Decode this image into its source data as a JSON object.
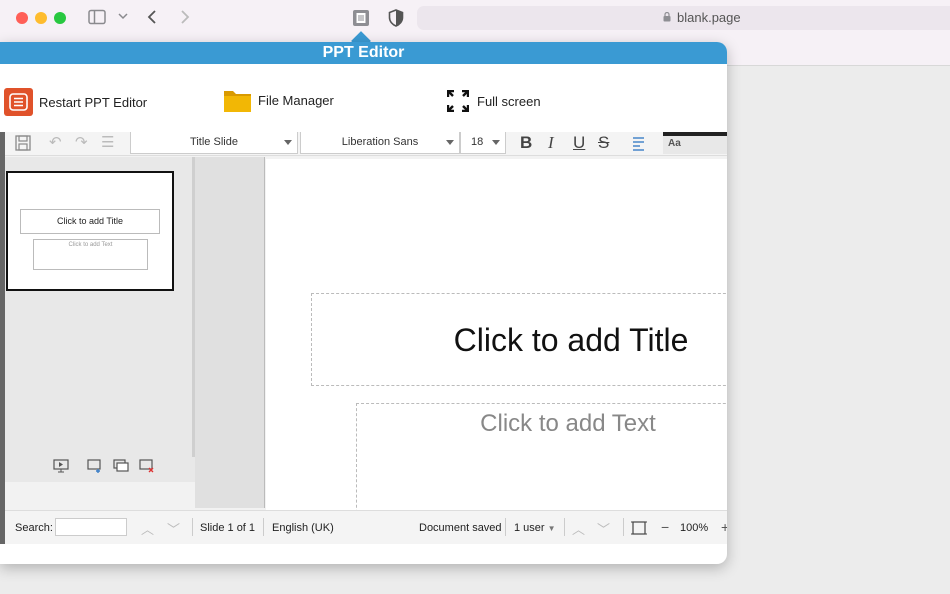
{
  "browser": {
    "url": "blank.page"
  },
  "popover": {
    "title": "PPT Editor",
    "launcher": {
      "restart_label": "Restart PPT Editor",
      "file_manager_label": "File Manager",
      "fullscreen_label": "Full screen"
    }
  },
  "toolbar": {
    "layout_value": "Title Slide",
    "font_value": "Liberation Sans",
    "size_value": "18",
    "bold": "B",
    "italic": "I",
    "underline": "U",
    "strike": "S",
    "case_label": "Aa"
  },
  "slides": {
    "thumb_title": "Click to add Title",
    "thumb_text": "Click to add Text"
  },
  "canvas": {
    "title_placeholder": "Click to add Title",
    "text_placeholder": "Click to add Text"
  },
  "status": {
    "search_label": "Search:",
    "slide_info": "Slide 1 of 1",
    "language": "English (UK)",
    "doc_state": "Document saved",
    "users": "1 user",
    "zoom": "100%"
  },
  "colors": {
    "accent": "#3a9ad3",
    "restart_icon": "#e0522a",
    "folder_icon": "#f2b705"
  }
}
